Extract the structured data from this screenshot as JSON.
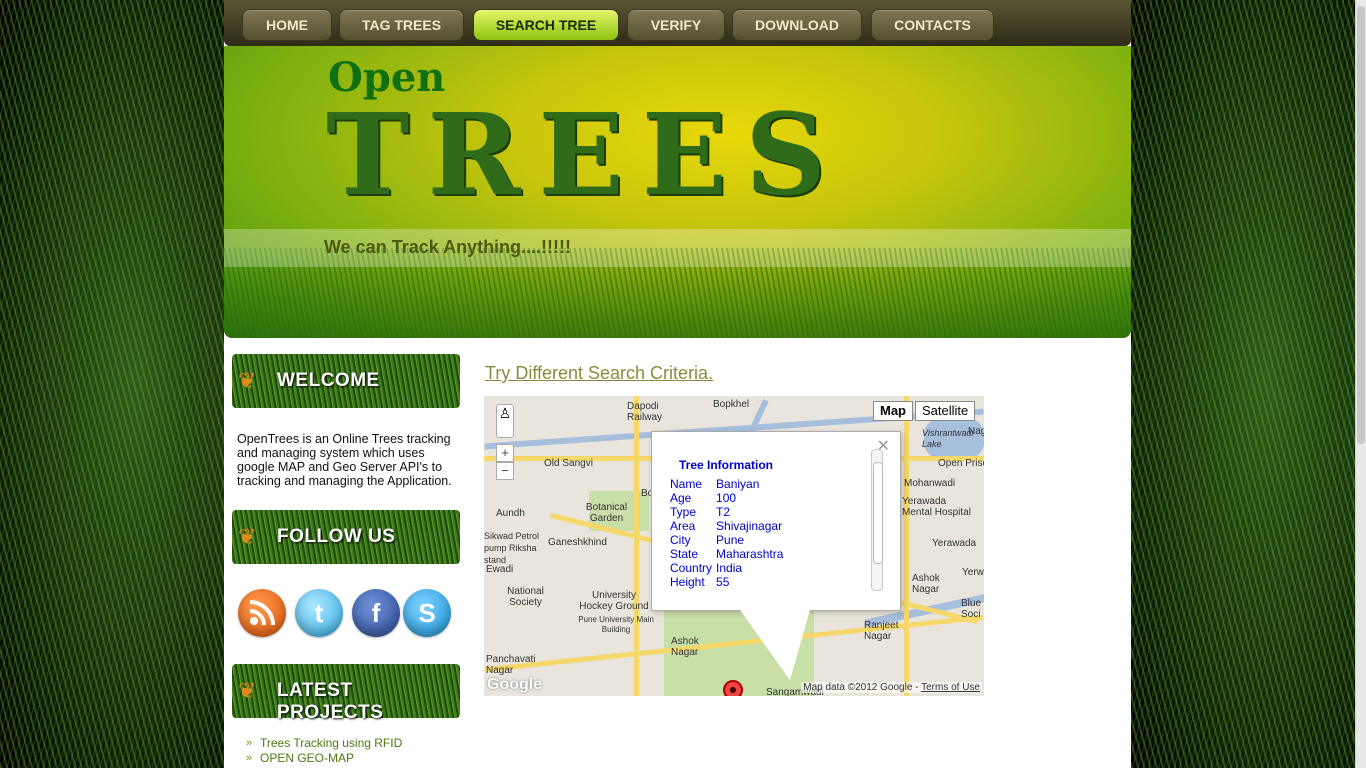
{
  "nav": {
    "items": [
      {
        "label": "HOME"
      },
      {
        "label": "TAG TREES"
      },
      {
        "label": "SEARCH TREE"
      },
      {
        "label": "VERIFY"
      },
      {
        "label": "DOWNLOAD"
      },
      {
        "label": "CONTACTS"
      }
    ],
    "active_index": 2
  },
  "header": {
    "logo_open": "Open",
    "logo_trees": "TREES",
    "tagline": "We can Track Anything....!!!!!"
  },
  "sidebar": {
    "welcome_title": "WELCOME",
    "welcome_text": "OpenTrees is an Online Trees tracking and managing system which uses google MAP and Geo Server API's to tracking and managing the Application.",
    "follow_title": "FOLLOW US",
    "social_icons": [
      "rss-icon",
      "twitter-icon",
      "facebook-icon",
      "skype-icon"
    ],
    "projects_title": "LATEST PROJECTS",
    "projects": [
      "Trees Tracking using RFID",
      "OPEN GEO-MAP"
    ]
  },
  "main": {
    "search_link": "Try Different Search Criteria."
  },
  "map": {
    "type_buttons": [
      "Map",
      "Satellite"
    ],
    "selected_type": "Map",
    "zoom_in": "+",
    "zoom_out": "−",
    "attribution": "Map data ©2012 Google - ",
    "terms": "Terms of Use",
    "google": "Google",
    "labels": [
      "Bopkhel",
      "Dapodi Railway",
      "Old Sangvi",
      "Aundh",
      "Botanical Garden",
      "Ganeshkhind",
      "Sikwad Petrol pump Riksha stand",
      "Ewadi",
      "National Society",
      "University Hockey Ground",
      "Pune University Main Building",
      "Panchavati Nagar",
      "Ashok Nagar",
      "Mohanwadi",
      "Yerawada Mental Hospital",
      "Yerawada",
      "Ashok Nagar",
      "Blue Soci",
      "Ranjeet Nagar",
      "Open Priso",
      "Vishrantwadi Lake",
      "Nag",
      "Bo",
      "Shivajinagar",
      "Sangamwadi",
      "Yerwad"
    ],
    "info": {
      "heading": "Tree Information",
      "rows": [
        {
          "k": "Name",
          "v": "Baniyan"
        },
        {
          "k": "Age",
          "v": "100"
        },
        {
          "k": "Type",
          "v": "T2"
        },
        {
          "k": "Area",
          "v": "Shivajinagar"
        },
        {
          "k": "City",
          "v": "Pune"
        },
        {
          "k": "State",
          "v": "Maharashtra"
        },
        {
          "k": "Country",
          "v": "India"
        },
        {
          "k": "Height",
          "v": "55"
        }
      ]
    }
  }
}
